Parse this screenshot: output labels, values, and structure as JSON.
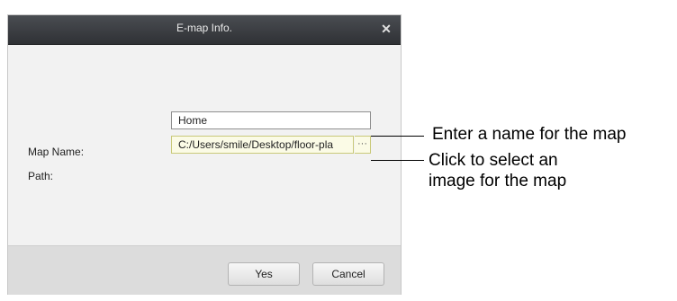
{
  "dialog": {
    "title": "E-map Info.",
    "close_icon": "close-icon"
  },
  "form": {
    "map_name_label": "Map Name:",
    "map_name_value": "Home",
    "path_label": "Path:",
    "path_value": "C:/Users/smile/Desktop/floor-pla",
    "browse_label": "···"
  },
  "buttons": {
    "yes": "Yes",
    "cancel": "Cancel"
  },
  "callouts": {
    "name_callout": "Enter a name for the map",
    "path_callout_line1": "Click to select an",
    "path_callout_line2": "image for the map"
  }
}
